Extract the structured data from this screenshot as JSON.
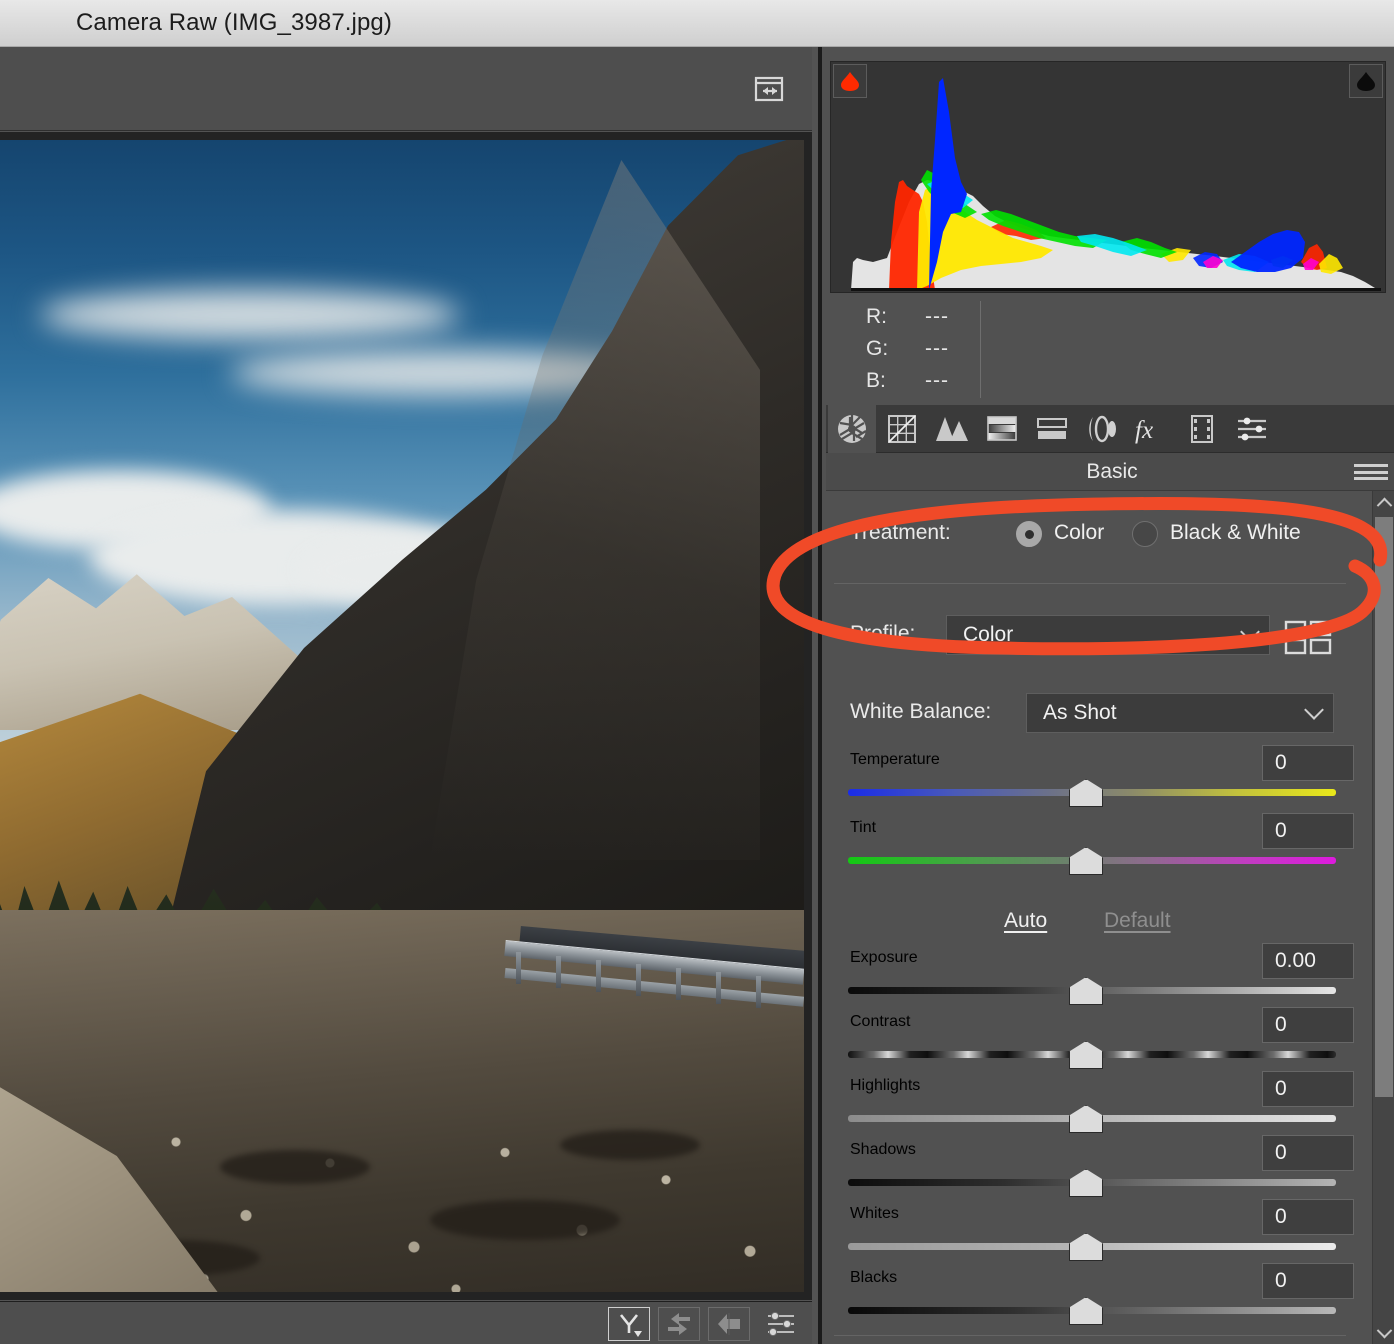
{
  "window": {
    "title": "Camera Raw (IMG_3987.jpg)"
  },
  "preview": {
    "resize_icon": "panel-resize-icon",
    "bottom_tools": [
      {
        "name": "preview-toggle",
        "glyph": "Y"
      },
      {
        "name": "swap-before-after",
        "glyph": "swap-arrows-icon"
      },
      {
        "name": "copy-settings-left",
        "glyph": "left-arrow-icon"
      },
      {
        "name": "preview-preferences",
        "glyph": "sliders-icon"
      }
    ]
  },
  "histogram": {
    "shadow_clipping_icon": "shadow-clipping-warning",
    "highlight_clipping_icon": "highlight-clipping-warning",
    "shadow_clip_color": "#FF2A00",
    "highlight_clip_color": "#000000"
  },
  "readout": {
    "rows": [
      {
        "channel": "R:",
        "value": "---"
      },
      {
        "channel": "G:",
        "value": "---"
      },
      {
        "channel": "B:",
        "value": "---"
      }
    ]
  },
  "tabs": [
    {
      "name": "tab-basic",
      "icon": "aperture-icon",
      "active": true
    },
    {
      "name": "tab-tone-curve",
      "icon": "tone-curve-icon",
      "active": false
    },
    {
      "name": "tab-detail",
      "icon": "triangles-detail-icon",
      "active": false
    },
    {
      "name": "tab-hsl-grayscale",
      "icon": "hsl-gradient-icon",
      "active": false
    },
    {
      "name": "tab-split-toning",
      "icon": "split-toning-icon",
      "active": false
    },
    {
      "name": "tab-lens-corrections",
      "icon": "lens-correction-icon",
      "active": false
    },
    {
      "name": "tab-effects",
      "icon": "fx-icon",
      "active": false
    },
    {
      "name": "tab-calibration",
      "icon": "film-strip-icon",
      "active": false
    },
    {
      "name": "tab-presets",
      "icon": "sliders-presets-icon",
      "active": false
    }
  ],
  "panel": {
    "title": "Basic",
    "menu_icon": "hamburger-menu-icon"
  },
  "basic": {
    "treatment": {
      "label": "Treatment:",
      "options": [
        {
          "label": "Color",
          "selected": true
        },
        {
          "label": "Black & White",
          "selected": false
        }
      ]
    },
    "profile": {
      "label": "Profile:",
      "value": "Color",
      "browse_icon": "profile-grid-icon"
    },
    "white_balance": {
      "label": "White Balance:",
      "value": "As Shot"
    },
    "auto_label": "Auto",
    "default_label": "Default",
    "sliders": [
      {
        "name": "temperature",
        "label": "Temperature",
        "value": "0",
        "pos": 50,
        "track": "temp"
      },
      {
        "name": "tint",
        "label": "Tint",
        "value": "0",
        "pos": 50,
        "track": "tint"
      },
      {
        "name": "exposure",
        "label": "Exposure",
        "value": "0.00",
        "pos": 50,
        "track": "exposure"
      },
      {
        "name": "contrast",
        "label": "Contrast",
        "value": "0",
        "pos": 50,
        "track": "contrast"
      },
      {
        "name": "highlights",
        "label": "Highlights",
        "value": "0",
        "pos": 50,
        "track": "highlights"
      },
      {
        "name": "shadows",
        "label": "Shadows",
        "value": "0",
        "pos": 50,
        "track": "shadows"
      },
      {
        "name": "whites",
        "label": "Whites",
        "value": "0",
        "pos": 50,
        "track": "whites"
      },
      {
        "name": "blacks",
        "label": "Blacks",
        "value": "0",
        "pos": 50,
        "track": "blacks"
      }
    ]
  },
  "annotation": {
    "shape": "ellipse-highlight",
    "color": "#F04A28",
    "target": "Profile row and Treatment row"
  },
  "colors": {
    "panel_bg": "#515151",
    "histogram_bg": "#343434",
    "titlebar_bg": "#DCDCDC",
    "accent_red": "#F04A28"
  }
}
